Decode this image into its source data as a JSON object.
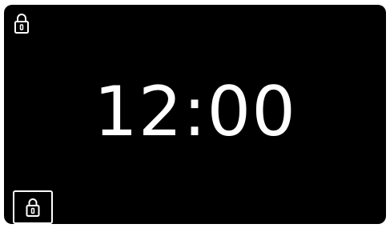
{
  "status_bar": {
    "lock_icon": "padlock-icon"
  },
  "clock": {
    "time": "12:00"
  },
  "controls": {
    "lock_button_icon": "padlock-icon"
  },
  "colors": {
    "screen_background": "#000000",
    "foreground": "#ffffff",
    "frame": "#ffffff"
  }
}
